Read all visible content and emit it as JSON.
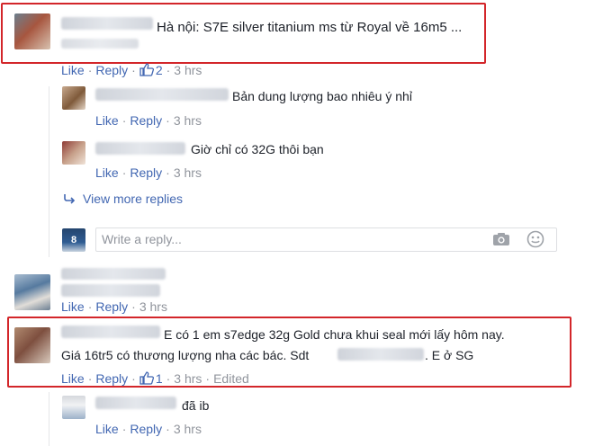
{
  "comments": [
    {
      "text": "Hà nội: S7E silver titanium ms từ Royal về 16m5 ...",
      "actions": {
        "like": "Like",
        "reply": "Reply",
        "likes": "2",
        "time": "3 hrs"
      },
      "replies": [
        {
          "text": "Bản dung lượng bao nhiêu ý nhỉ",
          "actions": {
            "like": "Like",
            "reply": "Reply",
            "time": "3 hrs"
          }
        },
        {
          "text": "Giờ chỉ có 32G thôi bạn",
          "actions": {
            "like": "Like",
            "reply": "Reply",
            "time": "3 hrs"
          }
        }
      ],
      "view_more": "View more replies",
      "reply_placeholder": "Write a reply..."
    },
    {
      "text": "",
      "actions": {
        "like": "Like",
        "reply": "Reply",
        "time": "3 hrs"
      }
    },
    {
      "text_line1": "E có 1 em s7edge 32g Gold chưa khui seal mới lấy hôm nay.",
      "text_line2a": "Giá 16tr5 có thương lượng nha các bác. Sdt",
      "text_line2b": ". E ở SG",
      "actions": {
        "like": "Like",
        "reply": "Reply",
        "likes": "1",
        "time": "3 hrs",
        "edited": "Edited"
      },
      "replies": [
        {
          "text": "đã ib",
          "actions": {
            "like": "Like",
            "reply": "Reply",
            "time": "3 hrs"
          }
        }
      ]
    }
  ],
  "colors": {
    "link": "#4267b2",
    "meta": "#90949c",
    "highlight": "#d3262a"
  },
  "icons": [
    "camera-icon",
    "emoji-icon",
    "like-thumb-icon",
    "reply-arrow-icon"
  ]
}
